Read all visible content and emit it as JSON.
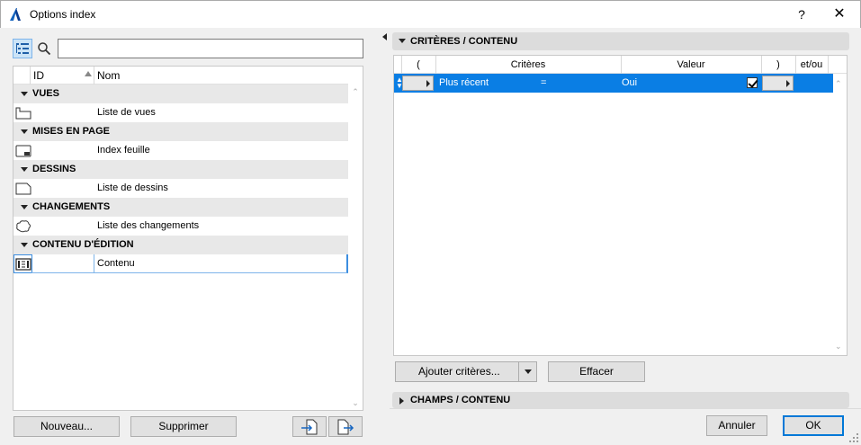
{
  "window": {
    "title": "Options index",
    "help": "?",
    "close": "✕"
  },
  "search": {
    "value": "",
    "placeholder": ""
  },
  "tree": {
    "columns": {
      "id": "ID",
      "name": "Nom"
    },
    "groups": [
      {
        "label": "VUES",
        "items": [
          {
            "name": "Liste de vues"
          }
        ]
      },
      {
        "label": "MISES EN PAGE",
        "items": [
          {
            "name": "Index feuille"
          }
        ]
      },
      {
        "label": "DESSINS",
        "items": [
          {
            "name": "Liste de dessins"
          }
        ]
      },
      {
        "label": "CHANGEMENTS",
        "items": [
          {
            "name": "Liste des changements"
          }
        ]
      },
      {
        "label": "CONTENU D'ÉDITION",
        "items": [
          {
            "name": "Contenu"
          }
        ]
      }
    ]
  },
  "left_buttons": {
    "new": "Nouveau...",
    "delete": "Supprimer"
  },
  "criteria_section": {
    "title": "CRITÈRES /  CONTENU",
    "columns": {
      "open": "(",
      "criteria": "Critères",
      "value": "Valeur",
      "close": ")",
      "andor": "et/ou"
    },
    "rows": [
      {
        "criterion": "Plus récent",
        "operator": "=",
        "value": "Oui",
        "checked": true
      }
    ],
    "add_button": "Ajouter critères...",
    "clear_button": "Effacer"
  },
  "fields_section": {
    "title": "CHAMPS /  CONTENU"
  },
  "dialog_buttons": {
    "cancel": "Annuler",
    "ok": "OK"
  },
  "colors": {
    "selection": "#0a7ee4",
    "accent": "#0078d7"
  }
}
